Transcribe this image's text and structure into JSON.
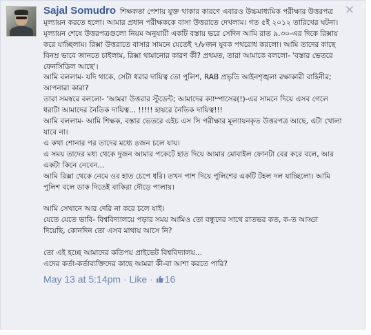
{
  "post": {
    "author": "Sajal Somudro",
    "first_line": "শিক্ষকতা পেশায় যুক্ত থাকার কারণে এবারও উচ্চমাধ্যমিক পরীক্ষার উত্তরপত্র",
    "lines": [
      "মূল্যায়ন করতে হলো। আমার প্রধান পরীক্ষককে বাসা উত্তরাতে দেখলাম। গত ৫ই ২০১২ তারিখের ঘটনা।",
      "মূল্যায়ন শেষে উত্তরপত্রগুলো নিয়ম অনুযায়ী একটি বস্তায় ভরে সেদিন আমি রাত ৯.৩০-এর দিকে রিক্সায়",
      "করে যাচ্ছিলাম। রিক্সা উত্তরাতে বাসার সামনে যেতেই ৭/৮জন যুবক পথরোধ করলো। আমি তাদের কাছে",
      "বিনম্র ভাবে জানতে চাইলাম, রিক্সা থামানোর কারণ কী? প্রথমত, তারা আমাকে বললো- 'বস্তার ভেতরে",
      "ফেনসিডিল আছে'।",
      "আমি বললাম- যদি থাকে, সেটা ধরার দায়িত্ব তো পুলিশ, RAB প্রভৃতি আইনশৃঙ্খলা রক্ষাকারী বাহিনীর;",
      "আপনারা কারা?",
      "তারা সমস্বরে বললো- 'আমরা উত্তরার স্টুডেন্ট; আমাদের ক্যাম্পাসের(!)-এর সামনে দিয়ে এসব গেলে",
      "ধরাটা আমাদের নৈতিক দায়িত্ব... !!!!! হায়রে নৈতিক দায়িত্ব!!!",
      "আমি বললাম- আমি শিক্ষক, বস্তার ভেতরে এইচ এস সি পরীক্ষার মূল্যায়নকৃত উত্তরপত্র আছে, এটা খোলা",
      "যাবে না।",
      "এ কথা শোনার পর তাদের মধ্যে ৪জন চলে যায়।",
      "এ সময় তাদের মধ্য থেকে দুজন আমার পকেটে হাত দিয়ে আমার মোবাইল ফোনটা বের করে বলে, আর",
      "একটা কিনে নেবেন...",
      "আমি রিক্সা থেকে নেমে ওর হাত চেপে ধরি। তখন পাশ দিয়ে পুলিশের একটি টহল দল যাচ্ছিলো। আমি",
      "পুলিশ বলে ডাক দিতেই বাকিরা দৌড়ে পালায়।",
      "",
      "আমি সেখানে আর দেরি না করে চলে যাই।",
      "যেতে যেতে ভাবি- বিশ্ববিদ্যালয়ে পড়ার সময় আমিও তো বন্ধুদের সাথে রাতভর কত, ক-ত আড্ডা",
      "দিয়েছি, কোনদিন তো এসব মাথায় আসে নি?",
      "",
      "তো এই হচ্ছে আমাদের কতিপয় প্রাইভেট বিশ্ববিদ্যালয়...",
      "এদের কর্তা-কর্তাব্যক্তিদের কাছে আমরা কী-বা আশা করতে পারি?"
    ]
  },
  "meta": {
    "timestamp": "May 13 at 5:14pm",
    "separator": " · ",
    "like_label": "Like",
    "like_count": "16"
  },
  "close_glyph": "✕",
  "icons": {
    "like": "thumbs-up-icon",
    "close": "close-icon"
  },
  "colors": {
    "author": "#3b5998",
    "link": "#6d84b4",
    "meta": "#9197a3",
    "background": "#edeff4"
  }
}
